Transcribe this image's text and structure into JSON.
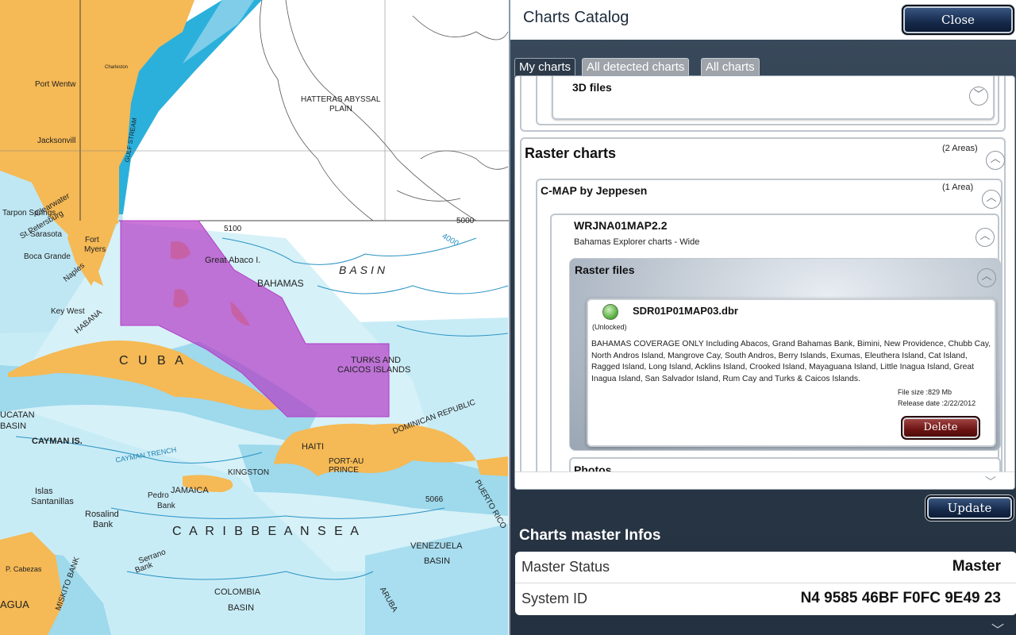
{
  "header": {
    "title": "Charts Catalog",
    "close_label": "Close"
  },
  "tabs": [
    {
      "label": "My charts",
      "active": true
    },
    {
      "label": "All detected charts",
      "active": false
    },
    {
      "label": "All charts",
      "active": false
    }
  ],
  "catalog": {
    "files3d_label": "3D files",
    "raster": {
      "title": "Raster charts",
      "count": "(2 Areas)"
    },
    "provider": {
      "title": "C-MAP by Jeppesen",
      "count": "(1 Area)"
    },
    "chart": {
      "code": "WRJNA01MAP2.2",
      "subtitle": "Bahamas Explorer charts - Wide"
    },
    "raster_files": {
      "title": "Raster files",
      "file": {
        "name": "SDR01P01MAP03.dbr",
        "status": "(Unlocked)",
        "description": "BAHAMAS COVERAGE ONLY Including Abacos, Grand Bahamas Bank, Bimini, New Providence, Chubb Cay, North Andros Island, Mangrove Cay, South Andros, Berry Islands, Exumas, Eleuthera Island, Cat Island, Ragged Island, Long Island, Acklins Island, Crooked Island, Mayaguana Island, Little Inagua Island, Great Inagua Island, San Salvador Island, Rum Cay and Turks & Caicos Islands.",
        "file_size": "File size :829 Mb",
        "release_date": "Release date :2/22/2012",
        "delete_label": "Delete"
      }
    },
    "photos_label": "Photos"
  },
  "update_label": "Update",
  "master": {
    "title": "Charts master Infos",
    "rows": [
      {
        "key": "Master Status",
        "value": "Master"
      },
      {
        "key": "System ID",
        "value": "N4 9585 46BF F0FC 9E49 23"
      }
    ]
  },
  "map": {
    "labels": {
      "hatteras": "HATTERAS ABYSSAL",
      "plain": "PLAIN",
      "basin": "BASIN",
      "great_abaco": "Great Abaco I.",
      "bahamas": "BAHAMAS",
      "cuba": "C U B A",
      "turks": "TURKS AND",
      "caicos": "CAICOS ISLANDS",
      "dominican": "DOMINICAN REPUBLIC",
      "haiti": "HAITI",
      "port_au_prince": "PORT-AU PRINCE",
      "cayman": "CAYMAN IS.",
      "cayman_trench": "CAYMAN TRENCH",
      "jamaica": "JAMAICA",
      "kingston": "KINGSTON",
      "caribbean": "C A R I B B E A N   S E A",
      "venezuela": "VENEZUELA",
      "venezuela_basin": "BASIN",
      "colombia": "COLOMBIA",
      "colombia_basin": "BASIN",
      "rosalind": "Rosalind",
      "rosalind_bank": "Bank",
      "serrano": "Serrano",
      "serrano_bank": "Bank",
      "pedro": "Pedro",
      "pedro_bank": "Bank",
      "islas": "Islas",
      "santanillas": "Santanillas",
      "yucatan": "UCATAN",
      "yucatan_basin": "BASIN",
      "habana": "HABANA",
      "key_west": "Key West",
      "naples": "Naples",
      "fort_myers": "Fort",
      "myers": "Myers",
      "jacksonville": "Jacksonvill",
      "port_wentw": "Port Wentw",
      "charleston": "Charleston",
      "sarasota": "Sarasota",
      "tarpon": "Tarpon Springs",
      "clearwater": "Clearwater",
      "st_petersburg": "St.Petersburg",
      "boca_grande": "Boca Grande",
      "gulf_stream": "GULF STREAM",
      "puerto_rico": "PUERTO RICO",
      "aruba": "ARUBA",
      "miskito": "MISKITO BANK",
      "agua": "AGUA",
      "cabezas": "P. Cabezas",
      "depth_5100": "5100",
      "depth_4000": "4000",
      "depth_5000": "5000",
      "depth_5066": "5066"
    }
  }
}
